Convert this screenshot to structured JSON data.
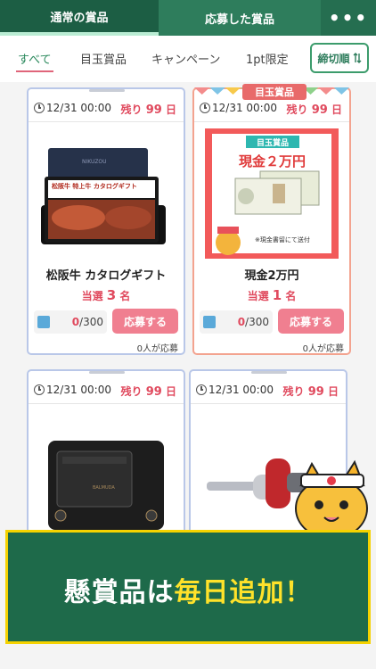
{
  "top_tabs": [
    {
      "label": "通常の賞品"
    },
    {
      "label": "応募した賞品"
    },
    {
      "label": "•••"
    }
  ],
  "filters": {
    "tabs": [
      {
        "label": "すべて"
      },
      {
        "label": "目玉賞品"
      },
      {
        "label": "キャンペーン"
      },
      {
        "label": "1pt限定"
      }
    ],
    "sort_label": "締切順",
    "sort_icon": "sort-updown-icon"
  },
  "cards": [
    {
      "deadline": "12/31 00:00",
      "remain_prefix": "残り",
      "remain_days": "99",
      "remain_suffix": "日",
      "title": "松阪牛 カタログギフト",
      "win_prefix": "当選",
      "win_count": "3",
      "win_suffix": "名",
      "current": "0",
      "total": "/300",
      "apply_label": "応募する",
      "applicants": "0人が応募",
      "image_text": "NIKUZOU",
      "image_sub": "松阪牛 特上牛 カタログギフト"
    },
    {
      "badge": "目玉賞品",
      "deadline": "12/31 00:00",
      "remain_prefix": "残り",
      "remain_days": "99",
      "remain_suffix": "日",
      "title": "現金2万円",
      "win_prefix": "当選",
      "win_count": "1",
      "win_suffix": "名",
      "current": "0",
      "total": "/300",
      "apply_label": "応募する",
      "applicants": "0人が応募",
      "image_badge": "目玉賞品",
      "image_title": "現金２万円",
      "image_note": "※現金書留にて送付"
    },
    {
      "deadline": "12/31 00:00",
      "remain_prefix": "残り",
      "remain_days": "99",
      "remain_suffix": "日",
      "image_text": "BALMUDA"
    },
    {
      "deadline": "12/31 00:00",
      "remain_prefix": "残り",
      "remain_days": "99",
      "remain_suffix": "日"
    }
  ],
  "banner": {
    "text_a": "懸賞品は",
    "text_b": "毎日追加",
    "text_c": "！"
  },
  "colors": {
    "brand_green": "#1f6b4d",
    "accent_pink": "#f07f90",
    "alert_red": "#e04a5e",
    "banner_border": "#f5d200"
  }
}
